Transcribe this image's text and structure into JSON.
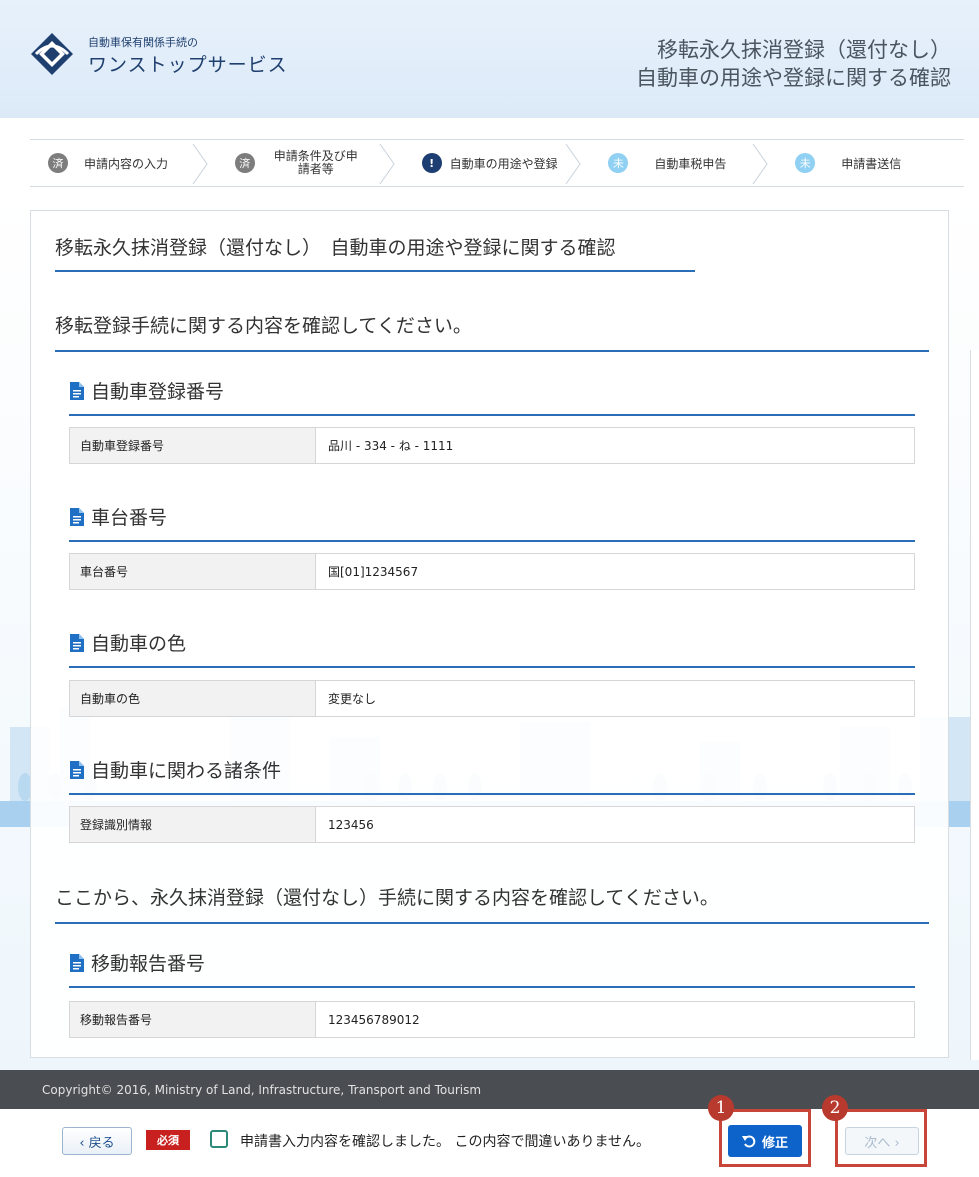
{
  "header": {
    "logo_small": "自動車保有関係手続の",
    "logo_large": "ワンストップサービス",
    "title_line1": "移転永久抹消登録（還付なし）",
    "title_line2": "自動車の用途や登録に関する確認"
  },
  "steps": [
    {
      "icon": "済",
      "label": "申請内容の入力",
      "status": "done"
    },
    {
      "icon": "済",
      "label": "申請条件及び申請者等",
      "status": "done"
    },
    {
      "icon": "!",
      "label": "自動車の用途や登録",
      "status": "current"
    },
    {
      "icon": "未",
      "label": "自動車税申告",
      "status": "todo"
    },
    {
      "icon": "未",
      "label": "申請書送信",
      "status": "todo"
    }
  ],
  "page_heading": "移転永久抹消登録（還付なし）　自動車の用途や登録に関する確認",
  "section1": {
    "heading": "移転登録手続に関する内容を確認してください。",
    "groups": [
      {
        "title": "自動車登録番号",
        "key": "自動車登録番号",
        "value": "品川 - 334 - ね - 1111"
      },
      {
        "title": "車台番号",
        "key": "車台番号",
        "value": "国[01]1234567"
      },
      {
        "title": "自動車の色",
        "key": "自動車の色",
        "value": "変更なし"
      },
      {
        "title": "自動車に関わる諸条件",
        "key": "登録識別情報",
        "value": "123456"
      }
    ]
  },
  "section2": {
    "heading": "ここから、永久抹消登録（還付なし）手続に関する内容を確認してください。",
    "groups": [
      {
        "title": "移動報告番号",
        "key": "移動報告番号",
        "value": "123456789012"
      }
    ]
  },
  "footer": {
    "copyright": "Copyright© 2016, Ministry of Land, Infrastructure, Transport and Tourism",
    "back_label": "‹ 戻る",
    "required_label": "必須",
    "confirm_text": "申請書入力内容を確認しました。 この内容で間違いありません。",
    "fix_label": "修正",
    "next_label": "次へ ›",
    "callout1": "1",
    "callout2": "2"
  },
  "colors": {
    "accent": "#2a6db8",
    "primary_button": "#0d63c9",
    "required_badge": "#c8201f",
    "callout": "#c8453a",
    "step_current": "#1d3e72",
    "step_todo": "#8fd0f3",
    "step_done": "#7d7d7d"
  }
}
